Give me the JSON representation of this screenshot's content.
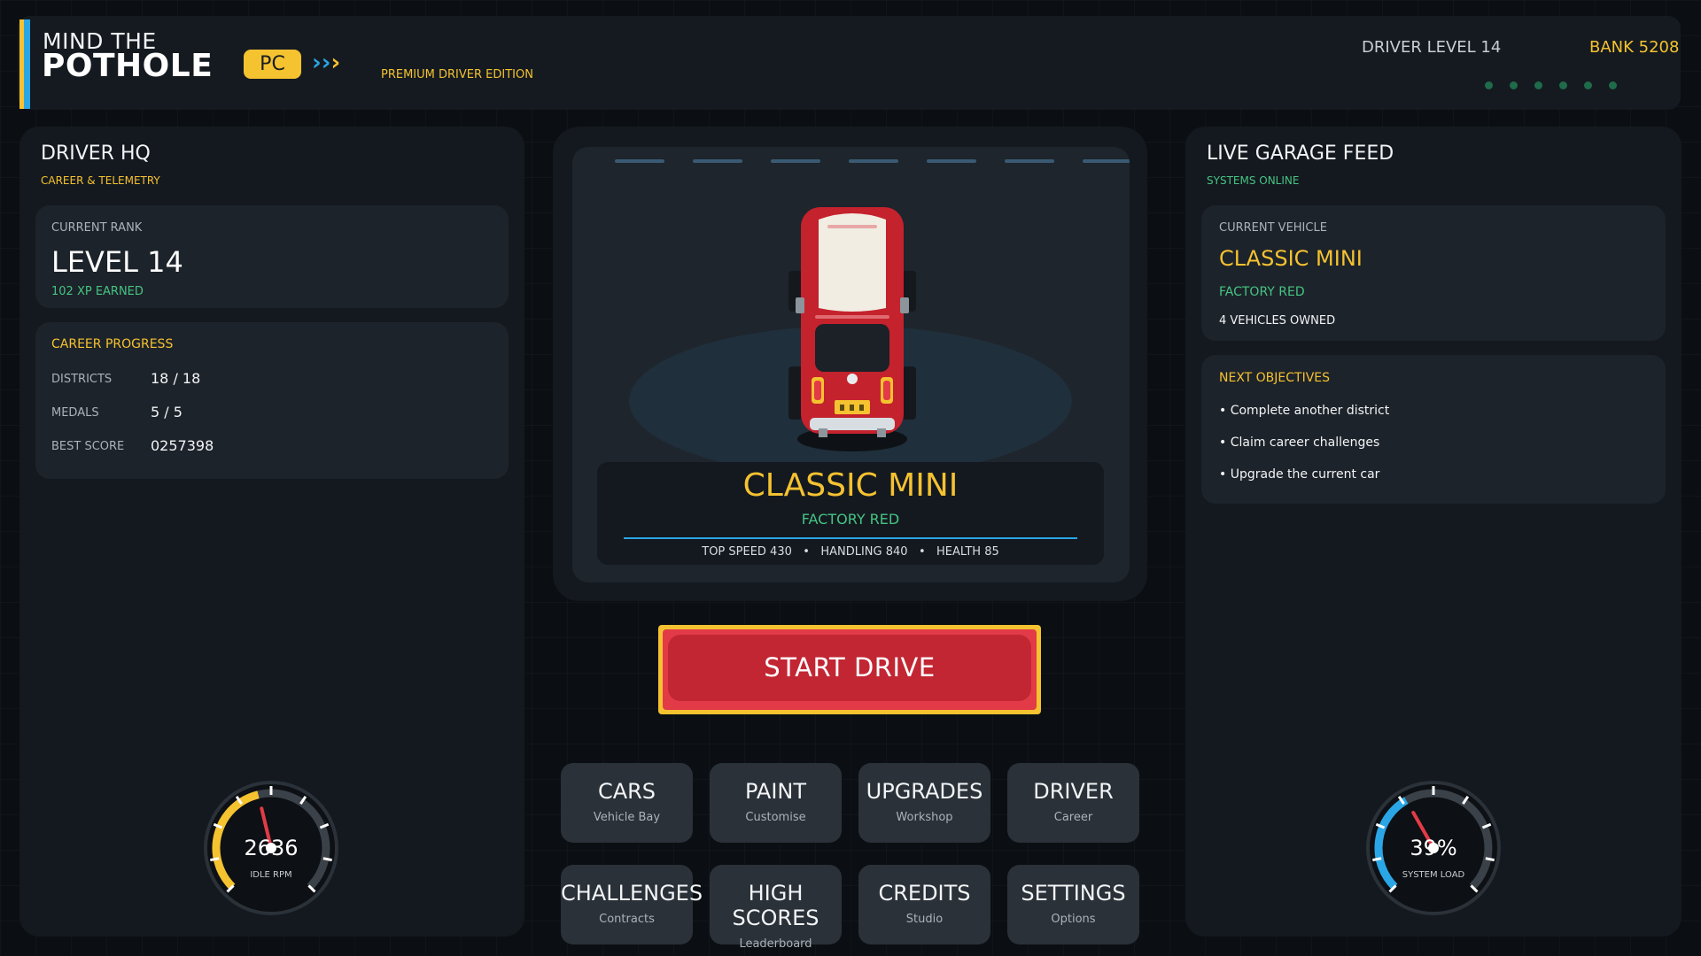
{
  "header": {
    "title_line1": "MIND THE",
    "title_line2": "POTHOLE",
    "platform": "PC",
    "chevrons": "›››",
    "edition": "PREMIUM DRIVER EDITION",
    "driver_level": "DRIVER LEVEL 14",
    "bank": "BANK 5208",
    "status_dots": 6
  },
  "left": {
    "title": "DRIVER HQ",
    "subtitle": "CAREER & TELEMETRY",
    "rank_label": "CURRENT RANK",
    "rank_value": "LEVEL 14",
    "xp": "102 XP EARNED",
    "progress_title": "CAREER PROGRESS",
    "stats": [
      {
        "label": "DISTRICTS",
        "value": "18 / 18"
      },
      {
        "label": "MEDALS",
        "value": "5 / 5"
      },
      {
        "label": "BEST SCORE",
        "value": "0257398"
      }
    ],
    "gauge": {
      "value": "2636",
      "label": "IDLE RPM",
      "fraction": 0.45
    }
  },
  "center": {
    "car_name": "CLASSIC MINI",
    "car_paint": "FACTORY RED",
    "car_stats": "TOP SPEED 430   •   HANDLING 840   •   HEALTH 85",
    "start_label": "START DRIVE",
    "menu": [
      {
        "title": "CARS",
        "sub": "Vehicle Bay"
      },
      {
        "title": "PAINT",
        "sub": "Customise"
      },
      {
        "title": "UPGRADES",
        "sub": "Workshop"
      },
      {
        "title": "DRIVER",
        "sub": "Career"
      },
      {
        "title": "CHALLENGES",
        "sub": "Contracts"
      },
      {
        "title": "HIGH SCORES",
        "sub": "Leaderboard"
      },
      {
        "title": "CREDITS",
        "sub": "Studio"
      },
      {
        "title": "SETTINGS",
        "sub": "Options"
      }
    ]
  },
  "right": {
    "title": "LIVE GARAGE FEED",
    "subtitle": "SYSTEMS ONLINE",
    "vehicle_label": "CURRENT VEHICLE",
    "vehicle_name": "CLASSIC MINI",
    "vehicle_paint": "FACTORY RED",
    "vehicles_owned": "4 VEHICLES OWNED",
    "objectives_title": "NEXT OBJECTIVES",
    "objectives": [
      "• Complete another district",
      "• Claim career challenges",
      "• Upgrade the current car"
    ],
    "gauge": {
      "value": "39%",
      "label": "SYSTEM LOAD",
      "fraction": 0.39
    }
  },
  "colors": {
    "accent_yellow": "#f5c230",
    "accent_blue": "#2aa6e6",
    "accent_green": "#45c483",
    "start_red": "#c22633"
  }
}
